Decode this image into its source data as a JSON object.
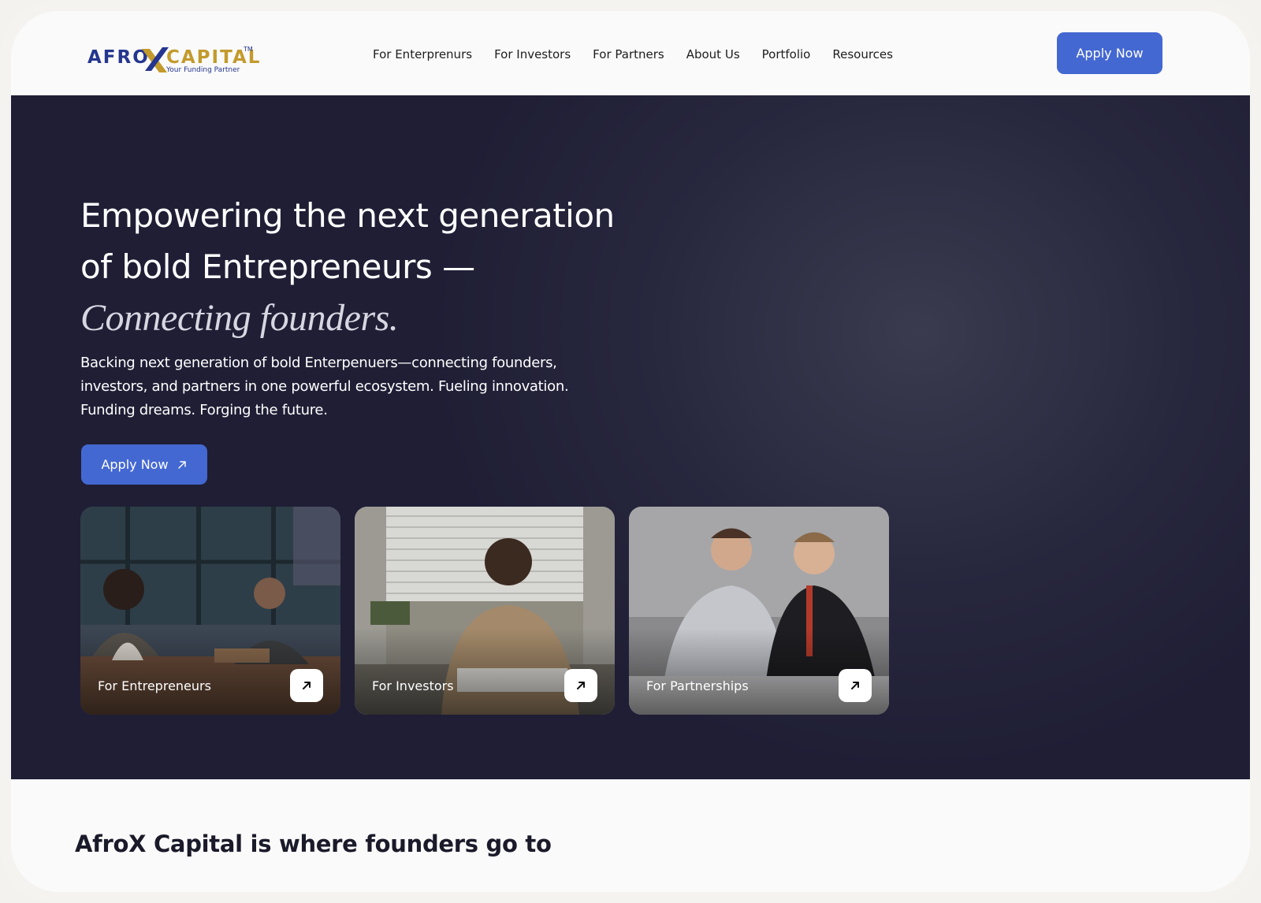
{
  "brand": {
    "name_part1": "AFRO",
    "name_part2": "CAPITAL",
    "trademark": "TM",
    "tagline": "Your Funding Partner",
    "colors": {
      "navy": "#24368f",
      "gold": "#c39a2c"
    }
  },
  "nav": {
    "items": [
      {
        "label": "For Enterprenurs"
      },
      {
        "label": "For Investors"
      },
      {
        "label": "For Partners"
      },
      {
        "label": "About Us"
      },
      {
        "label": "Portfolio"
      },
      {
        "label": "Resources"
      }
    ],
    "cta_label": "Apply Now"
  },
  "hero": {
    "headline_plain": "Empowering the next generation of bold Entrepreneurs — ",
    "headline_accent": "Connecting founders.",
    "subtext": "Backing next generation of bold Enterpenuers—connecting founders, investors, and partners in one powerful ecosystem. Fueling innovation. Funding dreams. Forging the future.",
    "cta_label": "Apply Now",
    "cta_icon": "arrow-up-right-icon",
    "cards": [
      {
        "label": "For Entrepreneurs",
        "icon": "arrow-up-right-icon"
      },
      {
        "label": "For Investors",
        "icon": "arrow-up-right-icon"
      },
      {
        "label": "For Partnerships",
        "icon": "arrow-up-right-icon"
      }
    ]
  },
  "section": {
    "intro": "AfroX Capital is where founders go to"
  },
  "colors": {
    "accent": "#4468d2",
    "hero_bg": "#22213a"
  }
}
